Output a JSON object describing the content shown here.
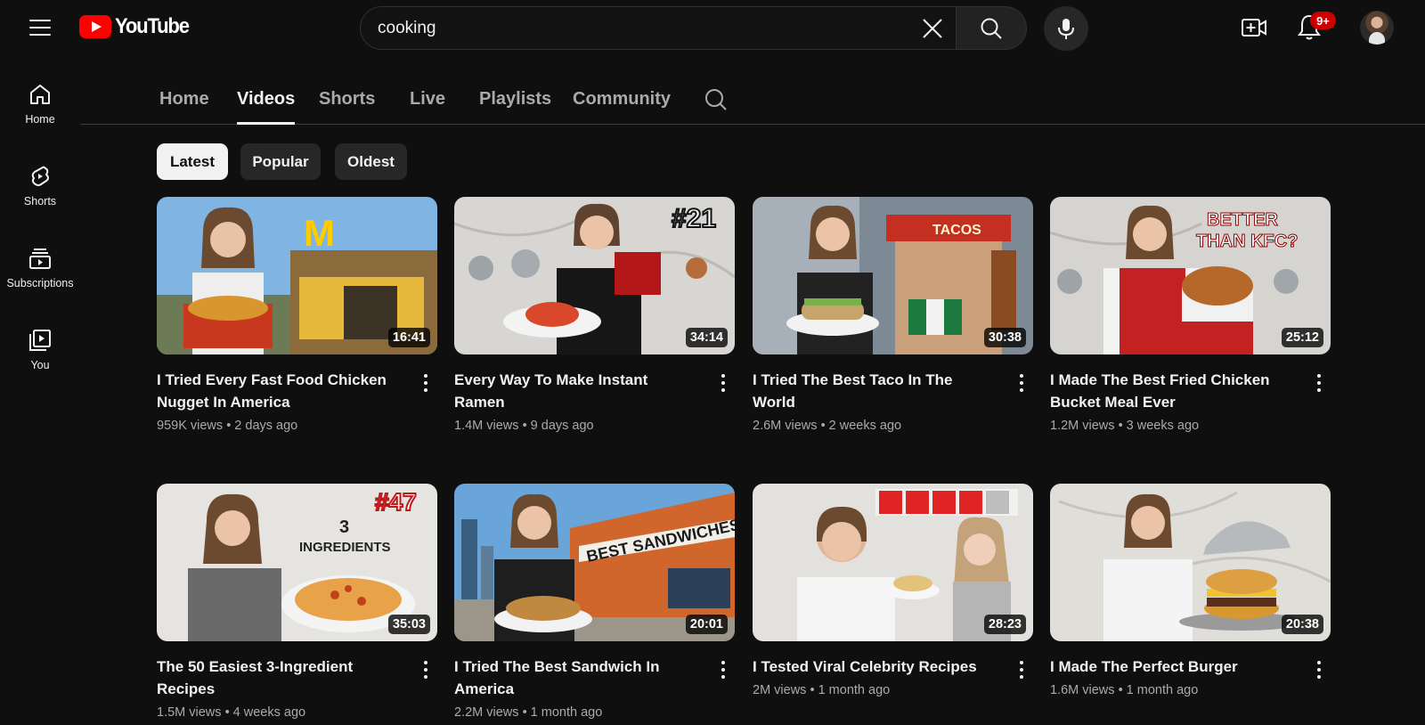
{
  "header": {
    "logo_text": "YouTube",
    "search_value": "cooking",
    "notification_badge": "9+",
    "icons": [
      "menu-icon",
      "youtube-logo",
      "close-icon",
      "search-icon",
      "microphone-icon",
      "create-video-icon",
      "bell-icon",
      "avatar"
    ]
  },
  "sidebar": {
    "items": [
      {
        "label": "Home",
        "icon": "home-icon"
      },
      {
        "label": "Shorts",
        "icon": "shorts-icon"
      },
      {
        "label": "Subscriptions",
        "icon": "subscriptions-icon"
      },
      {
        "label": "You",
        "icon": "you-icon"
      }
    ]
  },
  "tabs": {
    "items": [
      {
        "label": "Home"
      },
      {
        "label": "Videos"
      },
      {
        "label": "Shorts"
      },
      {
        "label": "Live"
      },
      {
        "label": "Playlists"
      },
      {
        "label": "Community"
      }
    ],
    "active": "Videos"
  },
  "chips": {
    "items": [
      {
        "label": "Latest"
      },
      {
        "label": "Popular"
      },
      {
        "label": "Oldest"
      }
    ],
    "active": "Latest"
  },
  "videos": [
    {
      "title": "I Tried Every Fast Food Chicken Nugget In America",
      "duration": "16:41",
      "views": "959K views",
      "age": "2 days ago",
      "overlay": ""
    },
    {
      "title": "Every Way To Make Instant Ramen",
      "duration": "34:14",
      "views": "1.4M views",
      "age": "9 days ago",
      "overlay": "#21"
    },
    {
      "title": "I Tried The Best Taco In The World",
      "duration": "30:38",
      "views": "2.6M views",
      "age": "2 weeks ago",
      "overlay": "TACOS"
    },
    {
      "title": "I Made The Best Fried Chicken Bucket Meal Ever",
      "duration": "25:12",
      "views": "1.2M views",
      "age": "3 weeks ago",
      "overlay": "BETTER THAN KFC?"
    },
    {
      "title": "The 50 Easiest 3-Ingredient Recipes",
      "duration": "35:03",
      "views": "1.5M views",
      "age": "4 weeks ago",
      "overlay": "#47"
    },
    {
      "title": "I Tried The Best Sandwich In America",
      "duration": "20:01",
      "views": "2.2M views",
      "age": "1 month ago",
      "overlay": "BEST SANDWICHES"
    },
    {
      "title": "I Tested Viral Celebrity Recipes",
      "duration": "28:23",
      "views": "2M views",
      "age": "1 month ago",
      "overlay": ""
    },
    {
      "title": "I Made The Perfect Burger",
      "duration": "20:38",
      "views": "1.6M views",
      "age": "1 month ago",
      "overlay": ""
    }
  ],
  "video_stats_separator": "•"
}
